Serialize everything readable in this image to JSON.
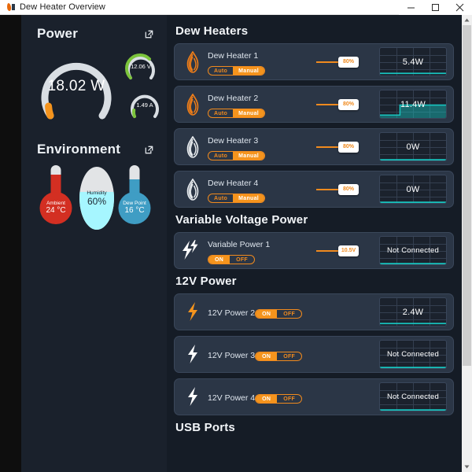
{
  "window": {
    "title": "Dew Heater Overview",
    "icon": "app-flame-icon",
    "minimize_label": "Minimize",
    "maximize_label": "Maximize",
    "close_label": "Close"
  },
  "colors": {
    "accent_orange": "#f5941d",
    "panel_bg": "#1a212c",
    "content_bg": "#151c26",
    "card_bg": "#2b3646",
    "card_border": "#3a475a",
    "chart_line": "#18c4bf",
    "gauge_track": "#d9dee3",
    "gauge_green": "#7cc43c",
    "ambient_red": "#d32f22",
    "dewpoint_blue": "#3f9dc4",
    "humidity_fill": "#a6f6ff"
  },
  "power_panel": {
    "title": "Power",
    "popout_icon": "external-link-icon",
    "main_gauge": {
      "value": "18.02 W",
      "percent": 18,
      "color": "#f5941d"
    },
    "voltage_gauge": {
      "value": "12.06 V",
      "percent": 80,
      "color": "#7cc43c"
    },
    "current_gauge": {
      "value": "1.49 A",
      "percent": 22,
      "color": "#7cc43c"
    }
  },
  "environment_panel": {
    "title": "Environment",
    "popout_icon": "external-link-icon",
    "ambient": {
      "name": "Ambient",
      "value": "24 °C",
      "fill_percent": 72,
      "color": "#d32f22",
      "icon": "thermometer-icon"
    },
    "humidity": {
      "name": "Humidity",
      "value": "60%",
      "fill_percent": 60,
      "color": "#a6f6ff",
      "icon": "humidity-drop-icon"
    },
    "dew_point": {
      "name": "Dew Point",
      "value": "16 °C",
      "fill_percent": 60,
      "color": "#3f9dc4",
      "icon": "thermometer-icon"
    }
  },
  "sections": [
    {
      "id": "dew-heaters",
      "title": "Dew Heaters",
      "cards": [
        {
          "name": "Dew Heater 1",
          "icon": "flame-icon",
          "icon_color": "#ef7d18",
          "modes": [
            "Auto",
            "Manual"
          ],
          "selected_mode": "Manual",
          "slider_value": "80%",
          "slider_percent": 80,
          "chart_value": "5.4W",
          "chart_shape": "flat-low"
        },
        {
          "name": "Dew Heater 2",
          "icon": "flame-icon",
          "icon_color": "#ef7d18",
          "modes": [
            "Auto",
            "Manual"
          ],
          "selected_mode": "Manual",
          "slider_value": "80%",
          "slider_percent": 80,
          "chart_value": "11.4W",
          "chart_shape": "step-up"
        },
        {
          "name": "Dew Heater 3",
          "icon": "flame-icon",
          "icon_color": "#e8ecef",
          "modes": [
            "Auto",
            "Manual"
          ],
          "selected_mode": "Manual",
          "slider_value": "80%",
          "slider_percent": 80,
          "chart_value": "0W",
          "chart_shape": "flat-zero"
        },
        {
          "name": "Dew Heater 4",
          "icon": "flame-icon",
          "icon_color": "#e8ecef",
          "modes": [
            "Auto",
            "Manual"
          ],
          "selected_mode": "Manual",
          "slider_value": "80%",
          "slider_percent": 80,
          "chart_value": "0W",
          "chart_shape": "flat-zero"
        }
      ]
    },
    {
      "id": "variable-voltage-power",
      "title": "Variable Voltage Power",
      "cards": [
        {
          "name": "Variable Power 1",
          "icon": "double-bolt-icon",
          "icon_color": "#ffffff",
          "modes": [
            "ON",
            "OFF"
          ],
          "selected_mode": "ON",
          "slider_value": "10.5V",
          "slider_percent": 72,
          "chart_value": "Not Connected",
          "chart_shape": "flat-zero"
        }
      ]
    },
    {
      "id": "twelve-volt-power",
      "title": "12V Power",
      "cards": [
        {
          "name": "12V Power 2",
          "icon": "bolt-icon",
          "icon_color": "#f5941d",
          "modes": [
            "ON",
            "OFF"
          ],
          "selected_mode": "ON",
          "chart_value": "2.4W",
          "chart_shape": "flat-low"
        },
        {
          "name": "12V Power 3",
          "icon": "bolt-icon",
          "icon_color": "#ffffff",
          "modes": [
            "ON",
            "OFF"
          ],
          "selected_mode": "ON",
          "chart_value": "Not Connected",
          "chart_shape": "flat-zero"
        },
        {
          "name": "12V Power 4",
          "icon": "bolt-icon",
          "icon_color": "#ffffff",
          "modes": [
            "ON",
            "OFF"
          ],
          "selected_mode": "ON",
          "chart_value": "Not Connected",
          "chart_shape": "flat-zero"
        }
      ]
    },
    {
      "id": "usb-ports",
      "title": "USB Ports",
      "cards": []
    }
  ],
  "scrollbar": {
    "up_arrow": "scroll-up-arrow-icon",
    "down_arrow": "scroll-down-arrow-icon",
    "thumb_top_percent": 0,
    "thumb_height_percent": 78
  }
}
